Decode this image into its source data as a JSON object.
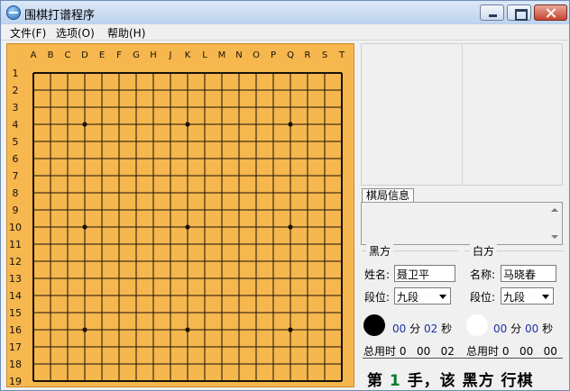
{
  "window": {
    "title": "围棋打谱程序"
  },
  "menu": [
    {
      "label": "文件(F)"
    },
    {
      "label": "选项(O)"
    },
    {
      "label": "帮助(H)"
    }
  ],
  "board": {
    "size": 19,
    "col_labels": [
      "A",
      "B",
      "C",
      "D",
      "E",
      "F",
      "G",
      "H",
      "J",
      "K",
      "L",
      "M",
      "N",
      "O",
      "P",
      "Q",
      "R",
      "S",
      "T"
    ],
    "row_labels": [
      "1",
      "2",
      "3",
      "4",
      "5",
      "6",
      "7",
      "8",
      "9",
      "10",
      "11",
      "12",
      "13",
      "14",
      "15",
      "16",
      "17",
      "18",
      "19"
    ],
    "star_points": [
      [
        4,
        4
      ],
      [
        10,
        4
      ],
      [
        16,
        4
      ],
      [
        4,
        10
      ],
      [
        10,
        10
      ],
      [
        16,
        10
      ],
      [
        4,
        16
      ],
      [
        10,
        16
      ],
      [
        16,
        16
      ]
    ],
    "colors": {
      "wood": "#f5b74e",
      "line": "#1a1208",
      "label": "#1a1208"
    }
  },
  "info": {
    "tab_label": "棋局信息"
  },
  "black": {
    "group_title": "黑方",
    "name_label": "姓名:",
    "name_value": "聂卫平",
    "rank_label": "段位:",
    "rank_value": "九段",
    "minutes": "00",
    "min_unit": "分",
    "seconds": "02",
    "sec_unit": "秒",
    "total_label": "总用时",
    "total_h": "0",
    "total_m": "00",
    "total_s": "02"
  },
  "white": {
    "group_title": "白方",
    "name_label": "名称:",
    "name_value": "马晓春",
    "rank_label": "段位:",
    "rank_value": "九段",
    "minutes": "00",
    "min_unit": "分",
    "seconds": "00",
    "sec_unit": "秒",
    "total_label": "总用时",
    "total_h": "0",
    "total_m": "00",
    "total_s": "00"
  },
  "status": {
    "prefix": "第",
    "move": "1",
    "mid": "手，该",
    "side": "黑方",
    "suffix": "行棋"
  }
}
